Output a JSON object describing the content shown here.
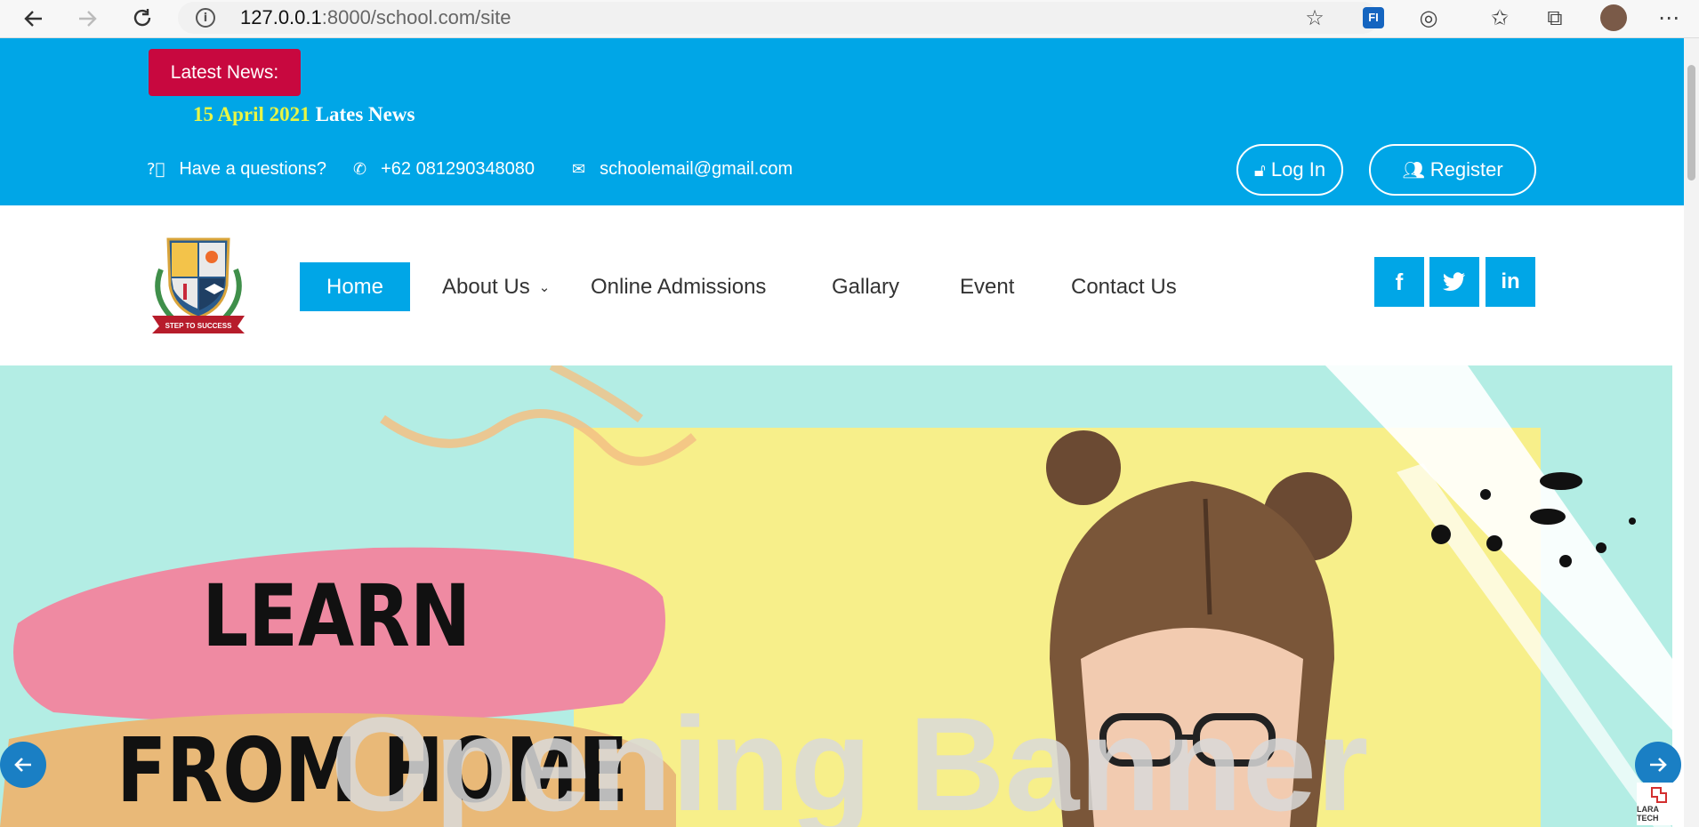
{
  "browser": {
    "url_host": "127.0.0.1",
    "url_path": ":8000/school.com/site",
    "back_icon": "arrow-left-icon",
    "forward_icon": "arrow-right-icon",
    "reload_icon": "reload-icon"
  },
  "news": {
    "badge": "Latest News:",
    "date": "15 April 2021",
    "text": "Lates News"
  },
  "contact": {
    "question": "Have a questions?",
    "phone": "+62 081290348080",
    "email": "schoolemail@gmail.com"
  },
  "auth": {
    "login": "Log In",
    "register": "Register"
  },
  "logo": {
    "ribbon": "STEP TO SUCCESS"
  },
  "nav": {
    "home": "Home",
    "about": "About Us",
    "admissions": "Online Admissions",
    "gallery": "Gallary",
    "event": "Event",
    "contact": "Contact Us"
  },
  "social": {
    "facebook": "f",
    "linkedin": "in"
  },
  "hero": {
    "learn": "LEARN",
    "from_home": "FROM HOME",
    "title": "Opening Banner"
  },
  "watermark": {
    "text": "LARA TECH"
  },
  "colors": {
    "primary": "#00a6e7",
    "news_badge": "#c8083f",
    "news_date": "#e8f545",
    "hero_bg": "#b3ede4",
    "hero_panel": "#f7ef8a"
  }
}
